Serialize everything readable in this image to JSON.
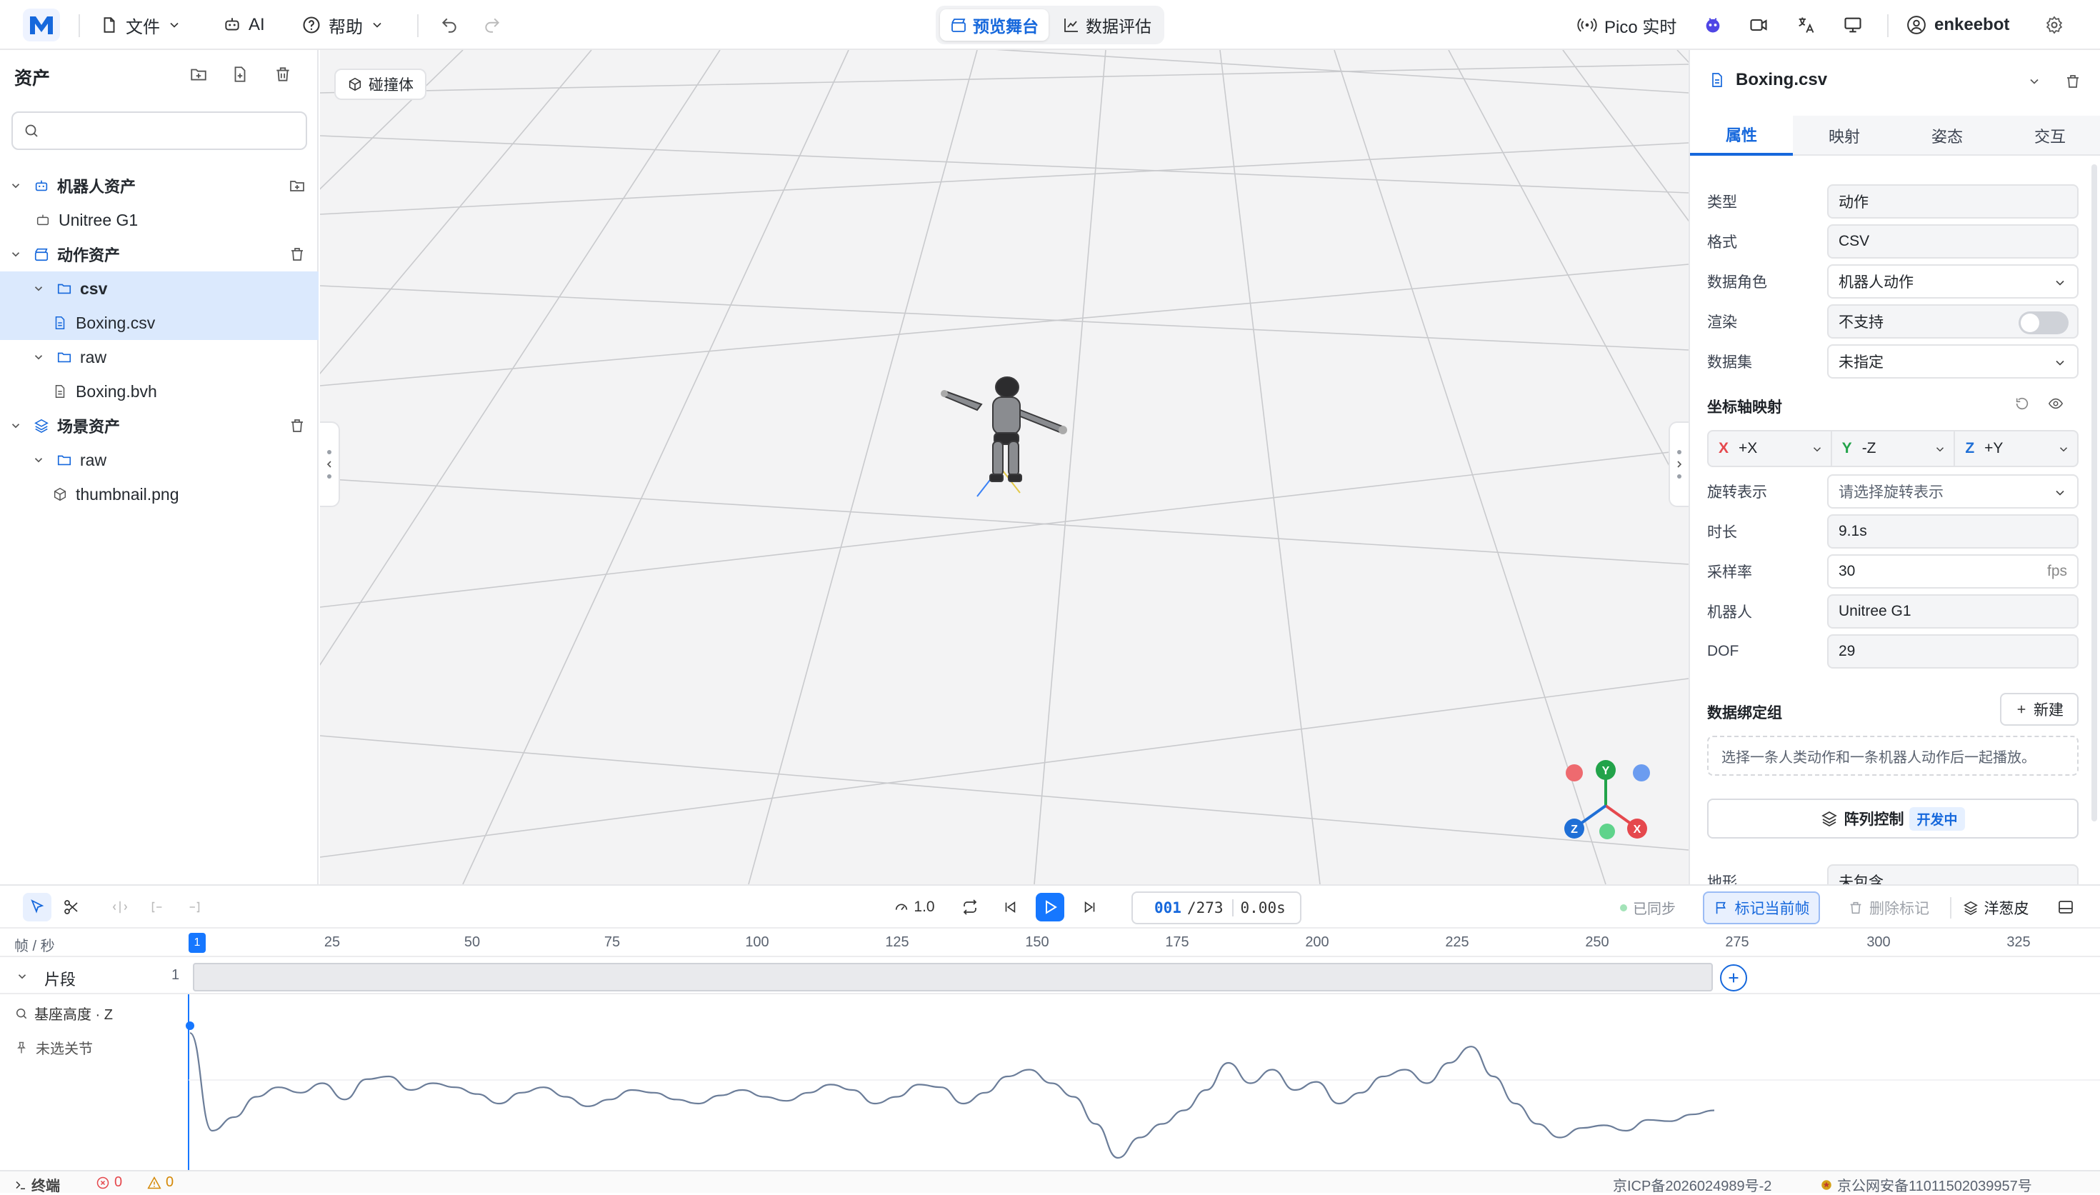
{
  "topbar": {
    "logo": "M",
    "file": "文件",
    "ai": "AI",
    "help": "帮助",
    "preview_stage": "预览舞台",
    "data_eval": "数据评估",
    "pico": "Pico 实时",
    "username": "enkeebot"
  },
  "left_panel": {
    "title": "资产",
    "search_placeholder": "",
    "groups": {
      "robot": {
        "label": "机器人资产",
        "items": [
          "Unitree G1"
        ]
      },
      "motion": {
        "label": "动作资产",
        "folder_csv": "csv",
        "file_csv": "Boxing.csv",
        "folder_raw": "raw",
        "file_bvh": "Boxing.bvh"
      },
      "scene": {
        "label": "场景资产",
        "folder_raw": "raw",
        "file_png": "thumbnail.png"
      }
    }
  },
  "viewport": {
    "collider_btn": "碰撞体",
    "gizmo": {
      "x": "X",
      "y": "Y",
      "z": "Z"
    }
  },
  "right_panel": {
    "file_title": "Boxing.csv",
    "tabs": [
      "属性",
      "映射",
      "姿态",
      "交互"
    ],
    "props": {
      "type_label": "类型",
      "type_value": "动作",
      "format_label": "格式",
      "format_value": "CSV",
      "role_label": "数据角色",
      "role_value": "机器人动作",
      "render_label": "渲染",
      "render_value": "不支持",
      "dataset_label": "数据集",
      "dataset_value": "未指定",
      "axis_title": "坐标轴映射",
      "axis_x": "X",
      "axis_x_val": "+X",
      "axis_y": "Y",
      "axis_y_val": "-Z",
      "axis_z": "Z",
      "axis_z_val": "+Y",
      "rotation_label": "旋转表示",
      "rotation_value": "请选择旋转表示",
      "duration_label": "时长",
      "duration_value": "9.1s",
      "rate_label": "采样率",
      "rate_value": "30",
      "rate_unit": "fps",
      "robot_label": "机器人",
      "robot_value": "Unitree G1",
      "dof_label": "DOF",
      "dof_value": "29",
      "binding_title": "数据绑定组",
      "new_btn": "新建",
      "binding_hint": "选择一条人类动作和一条机器人动作后一起播放。",
      "array_ctrl": "阵列控制",
      "array_badge": "开发中",
      "terrain_label": "地形",
      "terrain_value": "未包含"
    }
  },
  "timeline": {
    "speed": "1.0",
    "frame_current": "001",
    "frame_total": "/273",
    "time": "0.00s",
    "synced": "已同步",
    "mark_btn": "标记当前帧",
    "delete_mark_btn": "删除标记",
    "onion_btn": "洋葱皮",
    "ruler_label": "帧 / 秒",
    "ticks": [
      "1",
      "25",
      "50",
      "75",
      "100",
      "125",
      "150",
      "175",
      "200",
      "225",
      "250",
      "275",
      "300",
      "325"
    ],
    "track_label": "片段",
    "track_count": "1",
    "curve_label": "基座高度 · Z",
    "joint_label": "未选关节",
    "curve_values": [
      0.82,
      0.1,
      0.2,
      0.35,
      0.42,
      0.38,
      0.45,
      0.33,
      0.48,
      0.5,
      0.4,
      0.45,
      0.42,
      0.37,
      0.3,
      0.38,
      0.42,
      0.35,
      0.28,
      0.33,
      0.4,
      0.38,
      0.33,
      0.3,
      0.36,
      0.4,
      0.35,
      0.32,
      0.38,
      0.44,
      0.4,
      0.3,
      0.35,
      0.44,
      0.42,
      0.3,
      0.38,
      0.5,
      0.55,
      0.45,
      0.35,
      0.15,
      -0.1,
      0.05,
      0.15,
      0.25,
      0.4,
      0.6,
      0.45,
      0.55,
      0.4,
      0.46,
      0.3,
      0.38,
      0.5,
      0.55,
      0.45,
      0.6,
      0.72,
      0.5,
      0.3,
      0.15,
      0.05,
      0.12,
      0.14,
      0.1,
      0.18,
      0.17,
      0.22,
      0.25
    ]
  },
  "statusbar": {
    "terminal": "终端",
    "errors": "0",
    "warnings": "0",
    "icp": "京ICP备2026024989号-2",
    "police": "京公网安备11011502039957号"
  }
}
